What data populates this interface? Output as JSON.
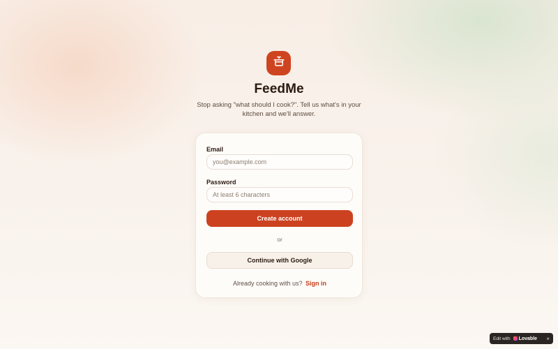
{
  "app": {
    "name": "FeedMe",
    "tagline": "Stop asking \"what should I cook?\". Tell us what's in your kitchen and we'll answer.",
    "logo_icon": "cooking-pot-icon",
    "brand_color": "#cf4420"
  },
  "form": {
    "email_label": "Email",
    "email_placeholder": "you@example.com",
    "email_value": "",
    "password_label": "Password",
    "password_placeholder": "At least 6 characters",
    "password_value": "",
    "submit_label": "Create account",
    "divider_text": "or",
    "google_label": "Continue with Google",
    "signin_prompt": "Already cooking with us?",
    "signin_link": "Sign in"
  },
  "badge": {
    "prefix": "Edit with",
    "brand": "Lovable",
    "close_icon": "close-icon",
    "close_glyph": "×"
  }
}
